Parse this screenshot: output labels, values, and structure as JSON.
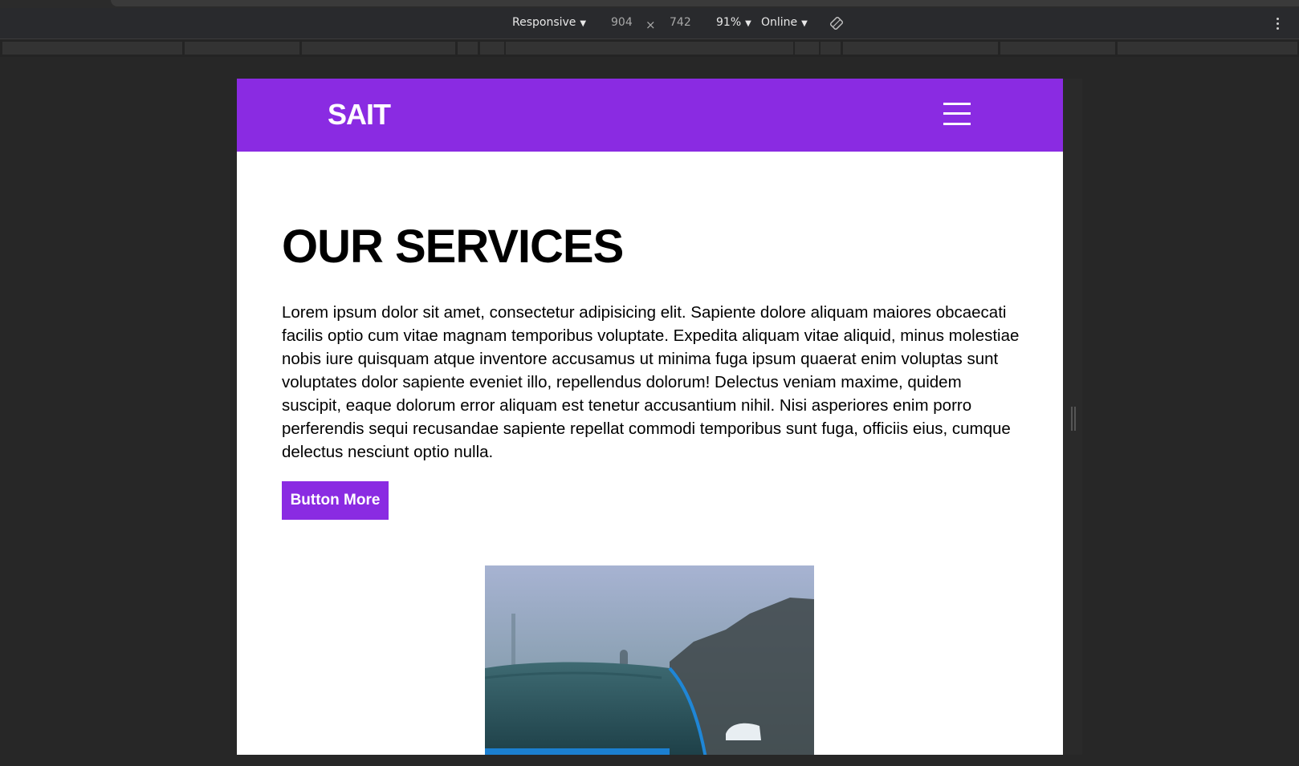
{
  "devtools": {
    "device_label": "Responsive",
    "width": "904",
    "times": "×",
    "height": "742",
    "zoom": "91%",
    "network": "Online"
  },
  "site": {
    "logo": "SAIT",
    "nav_color": "#8a2be2",
    "heading": "OUR SERVICES",
    "paragraph": "Lorem ipsum dolor sit amet, consectetur adipisicing elit. Sapiente dolore aliquam maiores obcaecati facilis optio cum vitae magnam temporibus voluptate. Expedita aliquam vitae aliquid, minus molestiae nobis iure quisquam atque inventore accusamus ut minima fuga ipsum quaerat enim voluptas sunt voluptates dolor sapiente eveniet illo, repellendus dolorum! Delectus veniam maxime, quidem suscipit, eaque dolorum error aliquam est tenetur accusantium nihil. Nisi asperiores enim porro perferendis sequi recusandae sapiente repellat commodi temporibus sunt fuga, officiis eius, cumque delectus nesciunt optio nulla.",
    "button_label": "Button More",
    "image_subject": "blue car in rain"
  }
}
